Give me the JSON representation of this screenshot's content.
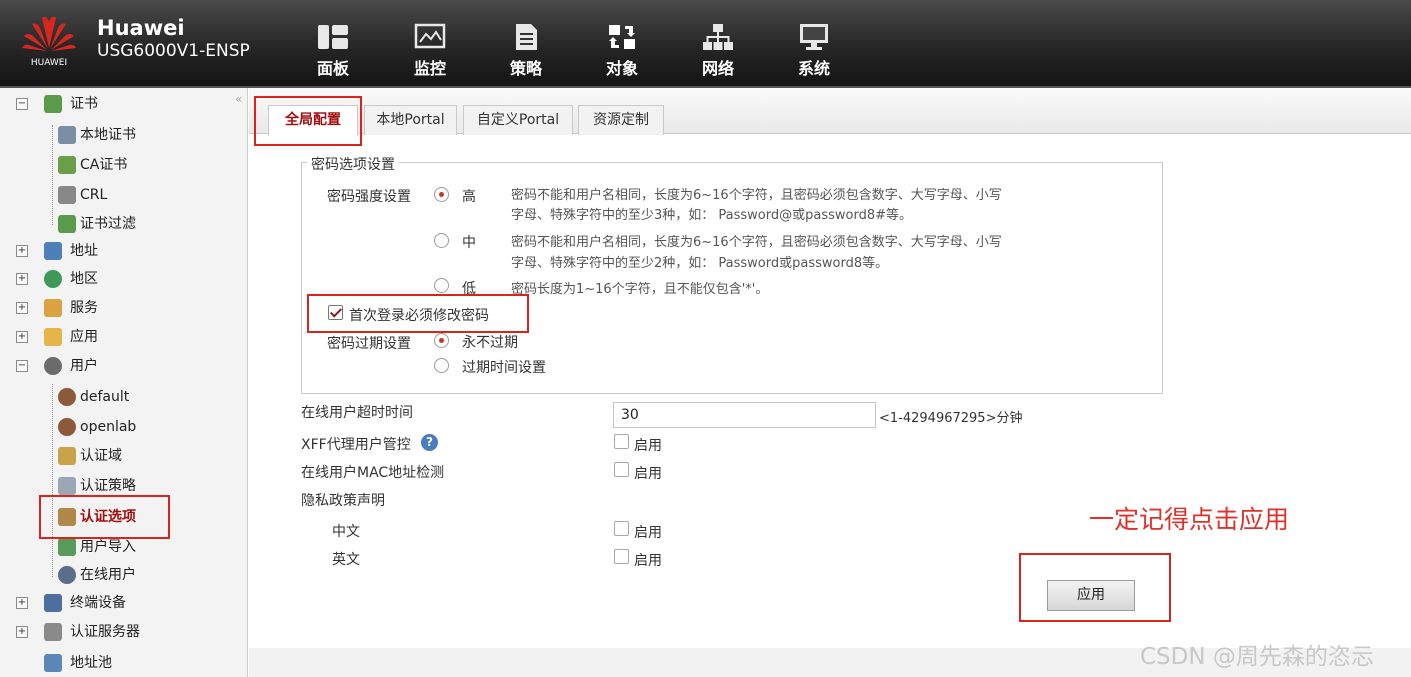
{
  "brand": {
    "name": "Huawei",
    "model": "USG6000V1-ENSP",
    "logo_text": "HUAWEI"
  },
  "nav": [
    {
      "label": "面板",
      "icon": "dashboard-icon"
    },
    {
      "label": "监控",
      "icon": "monitor-icon"
    },
    {
      "label": "策略",
      "icon": "policy-icon"
    },
    {
      "label": "对象",
      "icon": "object-icon"
    },
    {
      "label": "网络",
      "icon": "network-icon"
    },
    {
      "label": "系统",
      "icon": "system-icon"
    }
  ],
  "sidebar": {
    "items": [
      {
        "label": "证书",
        "toggle": "−"
      },
      {
        "label": "本地证书"
      },
      {
        "label": "CA证书"
      },
      {
        "label": "CRL"
      },
      {
        "label": "证书过滤"
      },
      {
        "label": "地址",
        "toggle": "+"
      },
      {
        "label": "地区",
        "toggle": "+"
      },
      {
        "label": "服务",
        "toggle": "+"
      },
      {
        "label": "应用",
        "toggle": "+"
      },
      {
        "label": "用户",
        "toggle": "−"
      },
      {
        "label": "default"
      },
      {
        "label": "openlab"
      },
      {
        "label": "认证域"
      },
      {
        "label": "认证策略"
      },
      {
        "label": "认证选项"
      },
      {
        "label": "用户导入"
      },
      {
        "label": "在线用户"
      },
      {
        "label": "终端设备",
        "toggle": "+"
      },
      {
        "label": "认证服务器",
        "toggle": "+"
      },
      {
        "label": "地址池"
      }
    ],
    "collapse_glyph": "«"
  },
  "tabs": [
    "全局配置",
    "本地Portal",
    "自定义Portal",
    "资源定制"
  ],
  "password": {
    "legend": "密码选项设置",
    "strength_label": "密码强度设置",
    "options": [
      {
        "label": "高",
        "desc1": "密码不能和用户名相同，长度为6~16个字符，且密码必须包含数字、大写字母、小写",
        "desc2": "字母、特殊字符中的至少3种，如： Password@或password8#等。"
      },
      {
        "label": "中",
        "desc1": "密码不能和用户名相同，长度为6~16个字符，且密码必须包含数字、大写字母、小写",
        "desc2": "字母、特殊字符中的至少2种，如： Password或password8等。"
      },
      {
        "label": "低",
        "desc1": "密码长度为1~16个字符，且不能仅包含'*'。"
      }
    ],
    "first_login_label": "首次登录必须修改密码",
    "expire_label": "密码过期设置",
    "expire_options": [
      "永不过期",
      "过期时间设置"
    ]
  },
  "online": {
    "timeout_label": "在线用户超时时间",
    "timeout_value": "30",
    "timeout_hint": "<1-4294967295>分钟",
    "xff_label": "XFF代理用户管控",
    "help_glyph": "?",
    "mac_label": "在线用户MAC地址检测",
    "enable_label": "启用",
    "privacy_label": "隐私政策声明",
    "chinese_label": "中文",
    "english_label": "英文"
  },
  "apply_label": "应用",
  "annotation": "一定记得点击应用",
  "watermark": "CSDN @周先森的恣忈",
  "colors": {
    "accent": "#a01010",
    "highlight": "#d9231d",
    "topbar": "#262626"
  }
}
